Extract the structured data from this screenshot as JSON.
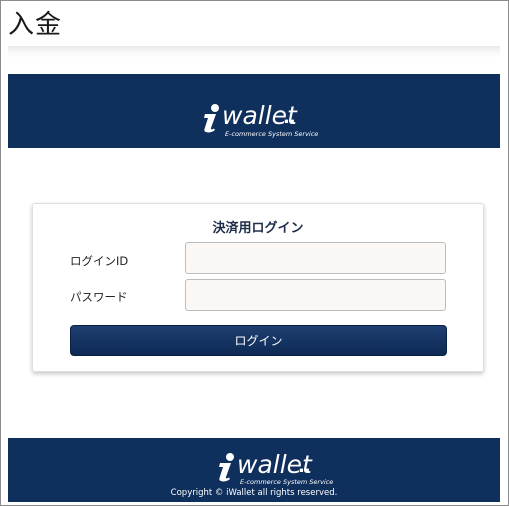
{
  "page": {
    "title": "入金"
  },
  "brand": {
    "name": "wallet",
    "dots": "..",
    "tagline": "E-commerce System Service",
    "color": "#0f2f5c"
  },
  "login": {
    "title": "決済用ログイン",
    "id_label": "ログインID",
    "id_value": "",
    "password_label": "パスワード",
    "password_value": "",
    "submit_label": "ログイン"
  },
  "footer": {
    "copyright": "Copyright © iWallet all rights reserved."
  }
}
